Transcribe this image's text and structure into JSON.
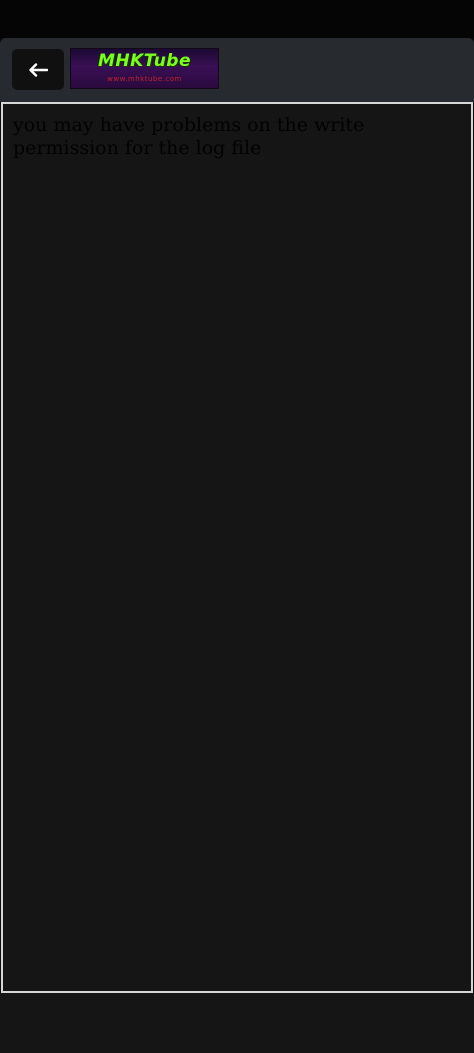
{
  "header": {
    "back_icon": "arrow-left-icon",
    "logo": {
      "title": "MHKTube",
      "subtitle": "www.mhktube.com",
      "title_color": "#7cff1e",
      "background": "#2a0a3e"
    }
  },
  "content": {
    "message": "you may have problems on the write permission for the log file"
  },
  "colors": {
    "app_bar": "#272b30",
    "content_background": "#151515",
    "frame_border": "#d6d6d6"
  }
}
